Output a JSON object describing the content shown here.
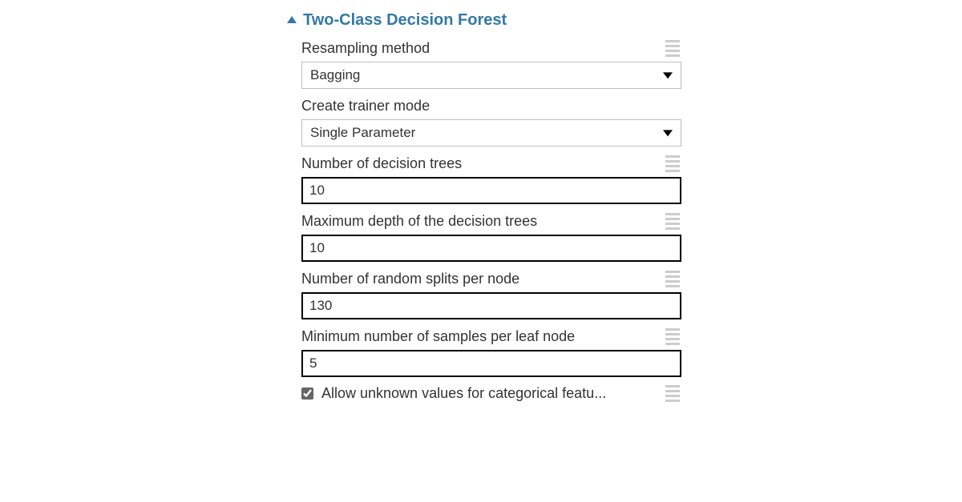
{
  "header": {
    "title": "Two-Class Decision Forest"
  },
  "fields": {
    "resampling": {
      "label": "Resampling method",
      "value": "Bagging"
    },
    "trainerMode": {
      "label": "Create trainer mode",
      "value": "Single Parameter"
    },
    "numTrees": {
      "label": "Number of decision trees",
      "value": "10"
    },
    "maxDepth": {
      "label": "Maximum depth of the decision trees",
      "value": "10"
    },
    "randomSplits": {
      "label": "Number of random splits per node",
      "value": "130"
    },
    "minSamples": {
      "label": "Minimum number of samples per leaf node",
      "value": "5"
    },
    "allowUnknown": {
      "label": "Allow unknown values for categorical featu...",
      "checked": true
    }
  }
}
